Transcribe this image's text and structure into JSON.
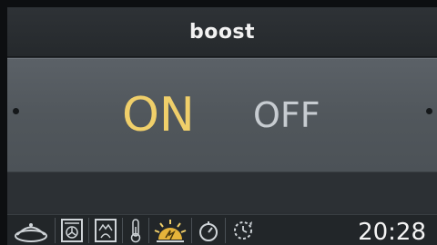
{
  "header": {
    "title": "boost"
  },
  "toggle": {
    "on_label": "ON",
    "off_label": "OFF",
    "selected": "ON"
  },
  "status": {
    "time": "20:28"
  },
  "colors": {
    "on_active": "#f0cf6a",
    "off_inactive": "#c7ccd1",
    "background": "#2b2f33"
  },
  "bottom_bar": {
    "icons": [
      "pot-lid-icon",
      "fan-oven-icon",
      "grill-icon",
      "thermometer-icon",
      "boost-sun-icon",
      "timer-icon",
      "delay-start-icon"
    ]
  }
}
